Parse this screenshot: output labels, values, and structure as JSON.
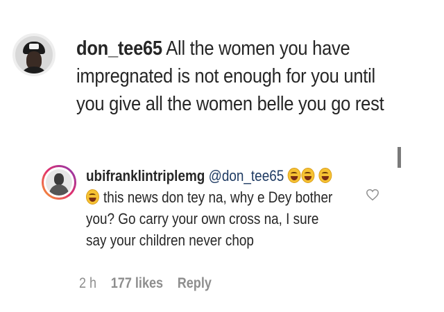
{
  "top_comment": {
    "username": "don_tee65",
    "text": " All the women you have impregnated is not enough for you until you give all the women belle you go rest",
    "avatar_icon": "profile-avatar-cap-icon"
  },
  "reply": {
    "username": "ubifranklintriplemg",
    "mention": "@don_tee65",
    "text": " this news don tey na, why e Dey bother you?  Go carry your own cross na, I sure say your children never chop",
    "emoji_icon": "face-with-tears-of-joy-icon",
    "avatar_icon": "profile-avatar-story-ring-icon",
    "time": "2 h",
    "likes": "177 likes",
    "reply_label": "Reply",
    "like_icon": "heart-outline-icon"
  },
  "colors": {
    "text": "#262626",
    "meta": "#8e8e8e",
    "mention": "#1f3b63",
    "story_ring_start": "#f9a12e",
    "story_ring_end": "#833ab4"
  }
}
